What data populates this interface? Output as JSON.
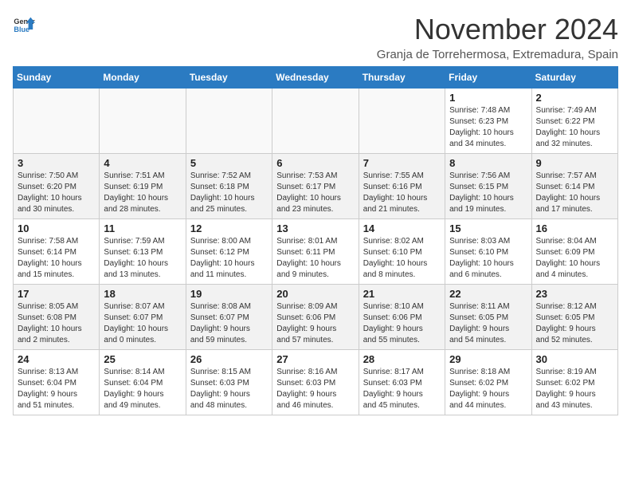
{
  "header": {
    "logo_line1": "General",
    "logo_line2": "Blue",
    "month_title": "November 2024",
    "location": "Granja de Torrehermosa, Extremadura, Spain"
  },
  "weekdays": [
    "Sunday",
    "Monday",
    "Tuesday",
    "Wednesday",
    "Thursday",
    "Friday",
    "Saturday"
  ],
  "weeks": [
    [
      {
        "day": "",
        "info": ""
      },
      {
        "day": "",
        "info": ""
      },
      {
        "day": "",
        "info": ""
      },
      {
        "day": "",
        "info": ""
      },
      {
        "day": "",
        "info": ""
      },
      {
        "day": "1",
        "info": "Sunrise: 7:48 AM\nSunset: 6:23 PM\nDaylight: 10 hours\nand 34 minutes."
      },
      {
        "day": "2",
        "info": "Sunrise: 7:49 AM\nSunset: 6:22 PM\nDaylight: 10 hours\nand 32 minutes."
      }
    ],
    [
      {
        "day": "3",
        "info": "Sunrise: 7:50 AM\nSunset: 6:20 PM\nDaylight: 10 hours\nand 30 minutes."
      },
      {
        "day": "4",
        "info": "Sunrise: 7:51 AM\nSunset: 6:19 PM\nDaylight: 10 hours\nand 28 minutes."
      },
      {
        "day": "5",
        "info": "Sunrise: 7:52 AM\nSunset: 6:18 PM\nDaylight: 10 hours\nand 25 minutes."
      },
      {
        "day": "6",
        "info": "Sunrise: 7:53 AM\nSunset: 6:17 PM\nDaylight: 10 hours\nand 23 minutes."
      },
      {
        "day": "7",
        "info": "Sunrise: 7:55 AM\nSunset: 6:16 PM\nDaylight: 10 hours\nand 21 minutes."
      },
      {
        "day": "8",
        "info": "Sunrise: 7:56 AM\nSunset: 6:15 PM\nDaylight: 10 hours\nand 19 minutes."
      },
      {
        "day": "9",
        "info": "Sunrise: 7:57 AM\nSunset: 6:14 PM\nDaylight: 10 hours\nand 17 minutes."
      }
    ],
    [
      {
        "day": "10",
        "info": "Sunrise: 7:58 AM\nSunset: 6:14 PM\nDaylight: 10 hours\nand 15 minutes."
      },
      {
        "day": "11",
        "info": "Sunrise: 7:59 AM\nSunset: 6:13 PM\nDaylight: 10 hours\nand 13 minutes."
      },
      {
        "day": "12",
        "info": "Sunrise: 8:00 AM\nSunset: 6:12 PM\nDaylight: 10 hours\nand 11 minutes."
      },
      {
        "day": "13",
        "info": "Sunrise: 8:01 AM\nSunset: 6:11 PM\nDaylight: 10 hours\nand 9 minutes."
      },
      {
        "day": "14",
        "info": "Sunrise: 8:02 AM\nSunset: 6:10 PM\nDaylight: 10 hours\nand 8 minutes."
      },
      {
        "day": "15",
        "info": "Sunrise: 8:03 AM\nSunset: 6:10 PM\nDaylight: 10 hours\nand 6 minutes."
      },
      {
        "day": "16",
        "info": "Sunrise: 8:04 AM\nSunset: 6:09 PM\nDaylight: 10 hours\nand 4 minutes."
      }
    ],
    [
      {
        "day": "17",
        "info": "Sunrise: 8:05 AM\nSunset: 6:08 PM\nDaylight: 10 hours\nand 2 minutes."
      },
      {
        "day": "18",
        "info": "Sunrise: 8:07 AM\nSunset: 6:07 PM\nDaylight: 10 hours\nand 0 minutes."
      },
      {
        "day": "19",
        "info": "Sunrise: 8:08 AM\nSunset: 6:07 PM\nDaylight: 9 hours\nand 59 minutes."
      },
      {
        "day": "20",
        "info": "Sunrise: 8:09 AM\nSunset: 6:06 PM\nDaylight: 9 hours\nand 57 minutes."
      },
      {
        "day": "21",
        "info": "Sunrise: 8:10 AM\nSunset: 6:06 PM\nDaylight: 9 hours\nand 55 minutes."
      },
      {
        "day": "22",
        "info": "Sunrise: 8:11 AM\nSunset: 6:05 PM\nDaylight: 9 hours\nand 54 minutes."
      },
      {
        "day": "23",
        "info": "Sunrise: 8:12 AM\nSunset: 6:05 PM\nDaylight: 9 hours\nand 52 minutes."
      }
    ],
    [
      {
        "day": "24",
        "info": "Sunrise: 8:13 AM\nSunset: 6:04 PM\nDaylight: 9 hours\nand 51 minutes."
      },
      {
        "day": "25",
        "info": "Sunrise: 8:14 AM\nSunset: 6:04 PM\nDaylight: 9 hours\nand 49 minutes."
      },
      {
        "day": "26",
        "info": "Sunrise: 8:15 AM\nSunset: 6:03 PM\nDaylight: 9 hours\nand 48 minutes."
      },
      {
        "day": "27",
        "info": "Sunrise: 8:16 AM\nSunset: 6:03 PM\nDaylight: 9 hours\nand 46 minutes."
      },
      {
        "day": "28",
        "info": "Sunrise: 8:17 AM\nSunset: 6:03 PM\nDaylight: 9 hours\nand 45 minutes."
      },
      {
        "day": "29",
        "info": "Sunrise: 8:18 AM\nSunset: 6:02 PM\nDaylight: 9 hours\nand 44 minutes."
      },
      {
        "day": "30",
        "info": "Sunrise: 8:19 AM\nSunset: 6:02 PM\nDaylight: 9 hours\nand 43 minutes."
      }
    ]
  ]
}
